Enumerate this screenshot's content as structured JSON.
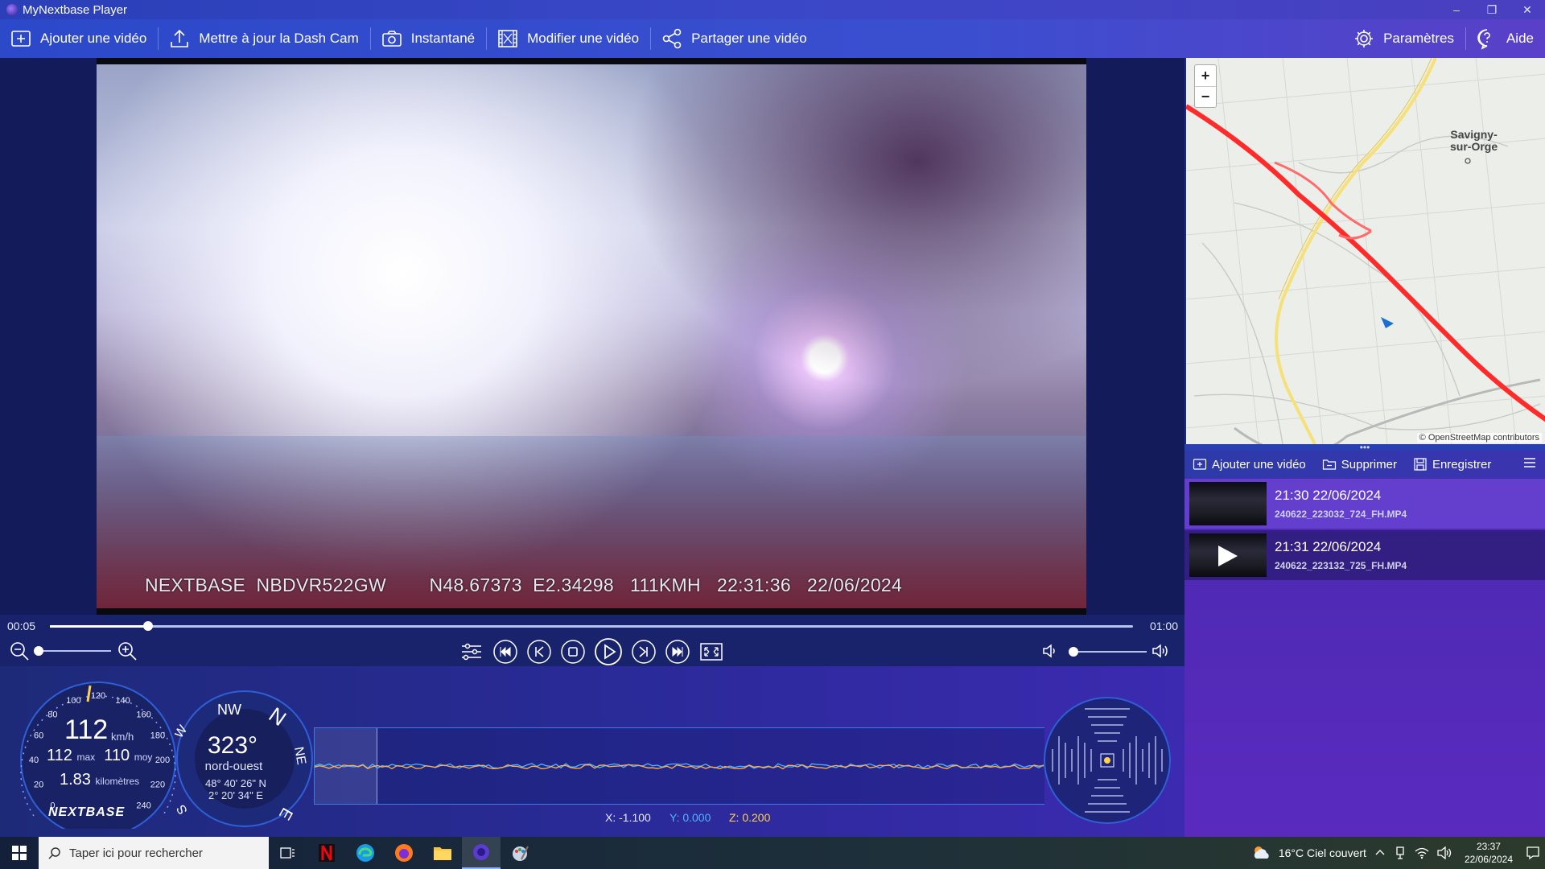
{
  "window": {
    "title": "MyNextbase Player",
    "controls": {
      "minimize": "–",
      "restore": "❐",
      "close": "✕"
    }
  },
  "toolbar": {
    "add_video": "Ajouter une vidéo",
    "update_dashcam": "Mettre à jour la Dash Cam",
    "snapshot": "Instantané",
    "edit_video": "Modifier une vidéo",
    "share_video": "Partager une vidéo",
    "settings": "Paramètres",
    "help": "Aide"
  },
  "video": {
    "osd_text": "NEXTBASE  NBDVR522GW        N48.67373  E2.34298   111KMH   22:31:36   22/06/2024"
  },
  "map": {
    "zoom_in": "+",
    "zoom_out": "−",
    "place_name": "Savigny-\nsur-Orge",
    "attribution": "© OpenStreetMap contributors",
    "route_color": "#ff1a1a"
  },
  "playlist": {
    "add_video": "Ajouter une vidéo",
    "delete": "Supprimer",
    "save": "Enregistrer",
    "items": [
      {
        "time": "21:30 22/06/2024",
        "file": "240622_223032_724_FH.MP4"
      },
      {
        "time": "21:31 22/06/2024",
        "file": "240622_223132_725_FH.MP4"
      }
    ]
  },
  "timeline": {
    "current": "00:05",
    "total": "01:00",
    "progress": 0.0909
  },
  "volume": {
    "level": 0.0
  },
  "zoom": {
    "level": 0.0
  },
  "gauge": {
    "speed": "112",
    "unit": "km/h",
    "max_value": "112",
    "max_label": "max",
    "avg_value": "110",
    "avg_label": "moy",
    "distance_value": "1.83",
    "distance_label": "kilomètres",
    "logo": "NEXTBASE",
    "ticks": [
      "0",
      "20",
      "40",
      "60",
      "80",
      "100",
      "120",
      "140",
      "160",
      "180",
      "200",
      "220",
      "240"
    ]
  },
  "compass": {
    "heading": "323°",
    "direction": "nord-ouest",
    "latitude": "48° 40' 26\" N",
    "longitude": "2° 20' 34\" E",
    "labels": {
      "nw": "NW",
      "n": "N",
      "ne": "NE",
      "e": "E",
      "w": "W",
      "s": "S"
    }
  },
  "gsensor": {
    "x": "X: -1.100",
    "y": "Y: 0.000",
    "z": "Z: 0.200",
    "x_color": "#e7eaff",
    "y_color": "#4fb4ff",
    "z_color": "#ffd24a"
  },
  "taskbar": {
    "search_placeholder": "Taper ici pour rechercher",
    "weather": "16°C  Ciel couvert",
    "time": "23:37",
    "date": "22/06/2024"
  }
}
